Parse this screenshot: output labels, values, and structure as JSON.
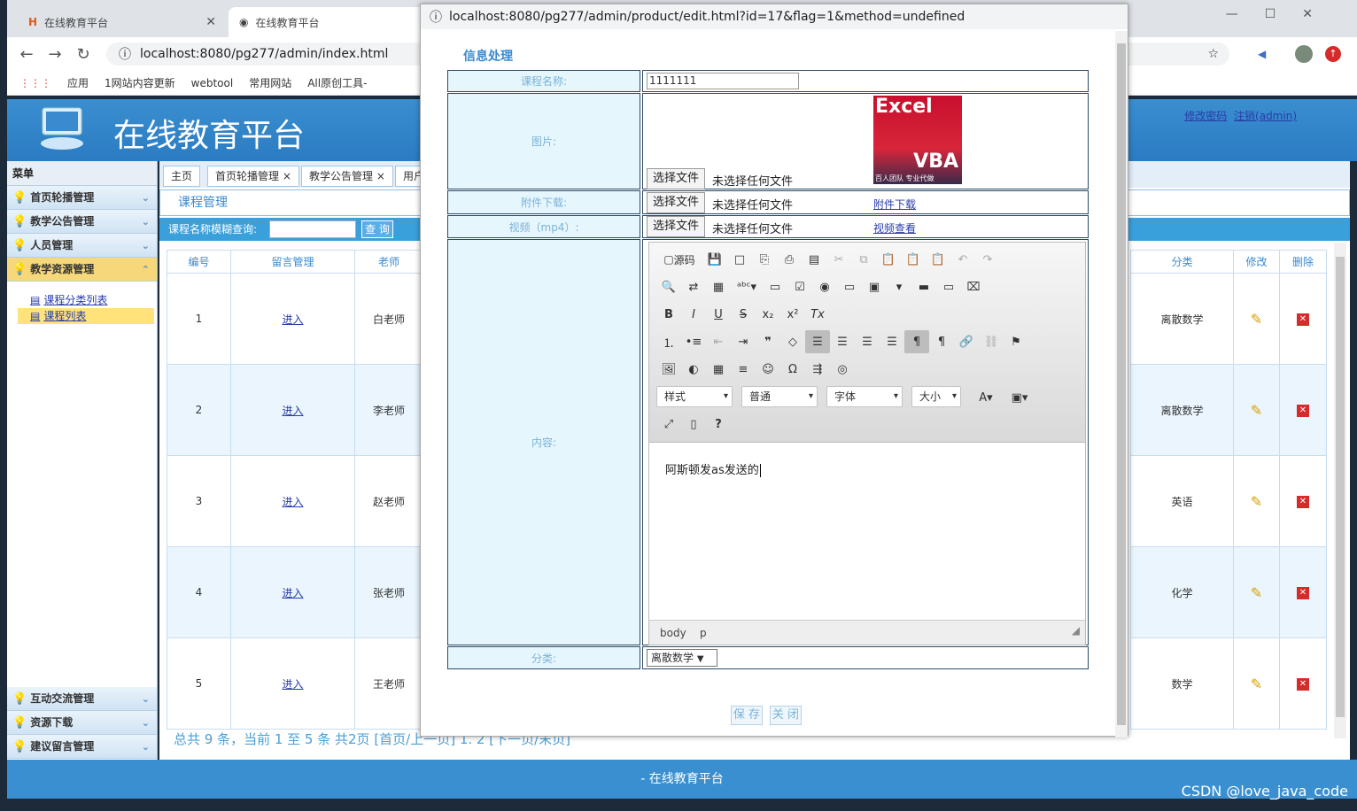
{
  "browser": {
    "tab1_title": "在线教育平台",
    "tab2_title": "在线教育平台",
    "url": "localhost:8080/pg277/admin/index.html",
    "bookmarks": [
      "应用",
      "1网站内容更新",
      "webtool",
      "常用网站",
      "All原创工具-"
    ]
  },
  "app": {
    "title": "在线教育平台",
    "change_password": "修改密码",
    "logout": "注销(admin)",
    "footer": "- 在线教育平台",
    "watermark": "CSDN @love_java_code"
  },
  "sidebar": {
    "header": "菜单",
    "items": [
      {
        "label": "首页轮播管理"
      },
      {
        "label": "教学公告管理"
      },
      {
        "label": "人员管理"
      },
      {
        "label": "教学资源管理"
      },
      {
        "label": "互动交流管理"
      },
      {
        "label": "资源下载"
      },
      {
        "label": "建议留言管理"
      }
    ],
    "sub_items": [
      {
        "label": "课程分类列表"
      },
      {
        "label": "课程列表"
      }
    ]
  },
  "page_tabs": [
    "主页",
    "首页轮播管理",
    "教学公告管理",
    "用户"
  ],
  "course": {
    "header": "课程管理",
    "search_label": "课程名称模糊查询:",
    "search_button": "查 询",
    "columns": [
      "编号",
      "留言管理",
      "老师",
      "分类",
      "修改",
      "删除"
    ],
    "rows": [
      {
        "id": "1",
        "link": "进入",
        "teacher": "白老师",
        "category": "离散数学"
      },
      {
        "id": "2",
        "link": "进入",
        "teacher": "李老师",
        "category": "离散数学"
      },
      {
        "id": "3",
        "link": "进入",
        "teacher": "赵老师",
        "category": "英语"
      },
      {
        "id": "4",
        "link": "进入",
        "teacher": "张老师",
        "category": "化学"
      },
      {
        "id": "5",
        "link": "进入",
        "teacher": "王老师",
        "category": "数学"
      }
    ],
    "pager": "总共 9 条，当前 1 至 5 条 共2页 [首页/上一页] 1. 2 [下一页/末页]"
  },
  "popup": {
    "url": "localhost:8080/pg277/admin/product/edit.html?id=17&flag=1&method=undefined",
    "title": "信息处理",
    "name_label": "课程名称:",
    "name_value": "1111111",
    "image_label": "图片:",
    "attachment_label": "附件下载:",
    "video_label": "视频（mp4）:",
    "content_label": "内容:",
    "category_label": "分类:",
    "choose_file": "选择文件",
    "no_file": "未选择任何文件",
    "attachment_link": "附件下载",
    "video_link": "视频查看",
    "image_text_1": "Excel",
    "image_text_2": "VBA",
    "image_text_3": "百人团队 专业代做",
    "source_label": "源码",
    "combo_style": "样式",
    "combo_format": "普通",
    "combo_font": "字体",
    "combo_size": "大小",
    "editor_text": "阿斯顿发as发送的",
    "path_body": "body",
    "path_p": "p",
    "category_value": "离散数学",
    "save": "保 存",
    "close": "关 闭"
  }
}
